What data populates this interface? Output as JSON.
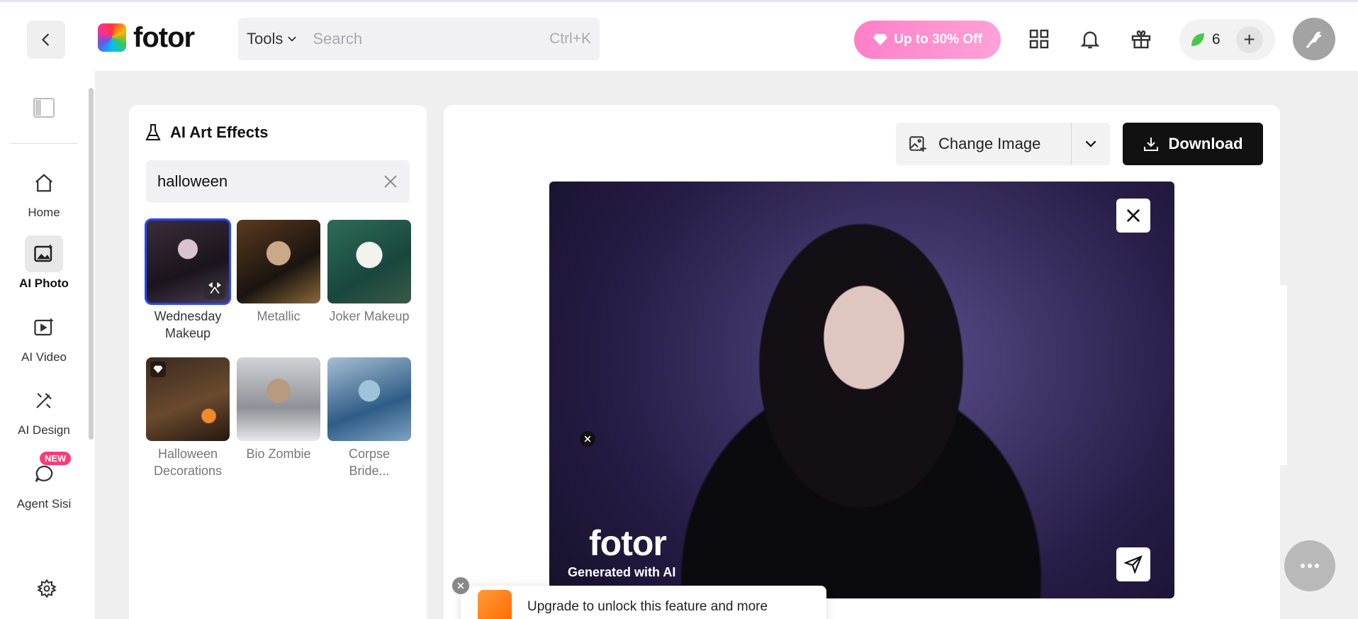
{
  "header": {
    "logo_text": "fotor",
    "tools_label": "Tools",
    "search_placeholder": "Search",
    "search_shortcut": "Ctrl+K",
    "promo_label": "Up to 30% Off",
    "credits_count": "6"
  },
  "sidebar": {
    "items": [
      {
        "label": "Home"
      },
      {
        "label": "AI Photo"
      },
      {
        "label": "AI Video"
      },
      {
        "label": "AI Design"
      },
      {
        "label": "Agent Sisi"
      }
    ],
    "new_badge": "NEW"
  },
  "panel": {
    "title": "AI Art Effects",
    "search_value": "halloween",
    "effects": [
      {
        "label": "Wednesday Makeup",
        "selected": true
      },
      {
        "label": "Metallic",
        "selected": false
      },
      {
        "label": "Joker Makeup",
        "selected": false
      },
      {
        "label": "Halloween Decorations",
        "selected": false
      },
      {
        "label": "Bio Zombie",
        "selected": false
      },
      {
        "label": "Corpse Bride...",
        "selected": false
      }
    ]
  },
  "canvas": {
    "change_image_label": "Change Image",
    "download_label": "Download",
    "watermark_logo": "fotor",
    "watermark_text": "Generated with AI"
  },
  "toast": {
    "text": "Upgrade to unlock this feature and more"
  },
  "colors": {
    "accent_selected": "#2945ff",
    "promo": "#ff7fc8",
    "download_bg": "#111111",
    "new_badge": "#ff3b76"
  }
}
